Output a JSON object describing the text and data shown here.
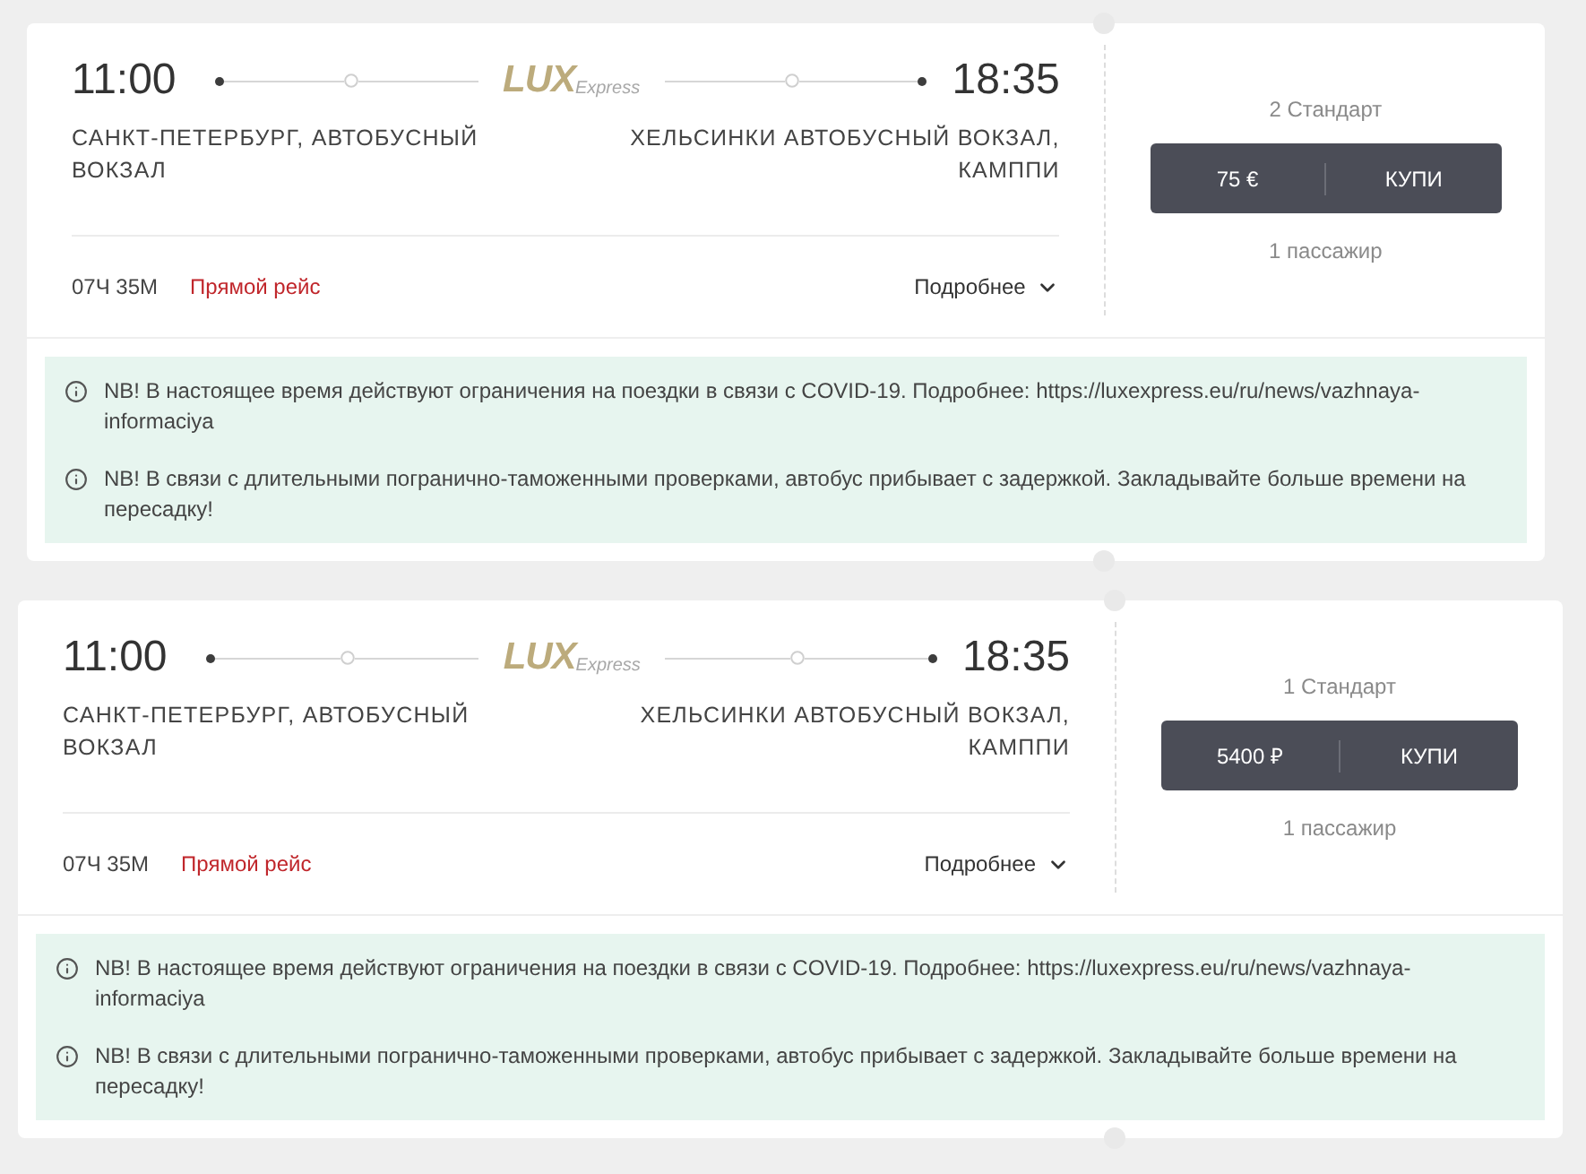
{
  "trips": [
    {
      "departure": {
        "time": "11:00",
        "station": "САНКТ-ПЕТЕРБУРГ, АВТОБУСНЫЙ ВОКЗАЛ"
      },
      "logo": {
        "main": "LUX",
        "sub": "Express"
      },
      "arrival": {
        "time": "18:35",
        "station": "ХЕЛЬСИНКИ АВТОБУСНЫЙ ВОКЗАЛ, КАМППИ"
      },
      "duration": "07Ч 35М",
      "route_type": "Прямой рейс",
      "details": {
        "label": "Подробнее",
        "expanded": false
      },
      "fare": {
        "seats": "2 Стандарт",
        "price": "75 €",
        "buy_label": "КУПИ",
        "passengers": "1 пассажир"
      },
      "notices": [
        "NB! В настоящее время действуют ограничения на поездки в связи с COVID-19. Подробнее: https://luxexpress.eu/ru/news/vazhnaya-informaciya",
        "NB! В связи с длительными погранично-таможенными проверками, автобус прибывает с задержкой. Закладывайте больше времени на пересадку!"
      ]
    },
    {
      "departure": {
        "time": "11:00",
        "station": "САНКТ-ПЕТЕРБУРГ, АВТОБУСНЫЙ ВОКЗАЛ"
      },
      "logo": {
        "main": "LUX",
        "sub": "Express"
      },
      "arrival": {
        "time": "18:35",
        "station": "ХЕЛЬСИНКИ АВТОБУСНЫЙ ВОКЗАЛ, КАМППИ"
      },
      "duration": "07Ч 35М",
      "route_type": "Прямой рейс",
      "details": {
        "label": "Подробнее",
        "expanded": false
      },
      "fare": {
        "seats": "1 Стандарт",
        "price": "5400 ₽",
        "buy_label": "КУПИ",
        "passengers": "1 пассажир"
      },
      "notices": [
        "NB! В настоящее время действуют ограничения на поездки в связи с COVID-19. Подробнее: https://luxexpress.eu/ru/news/vazhnaya-informaciya",
        "NB! В связи с длительными погранично-таможенными проверками, автобус прибывает с задержкой. Закладывайте больше времени на пересадку!"
      ]
    }
  ]
}
